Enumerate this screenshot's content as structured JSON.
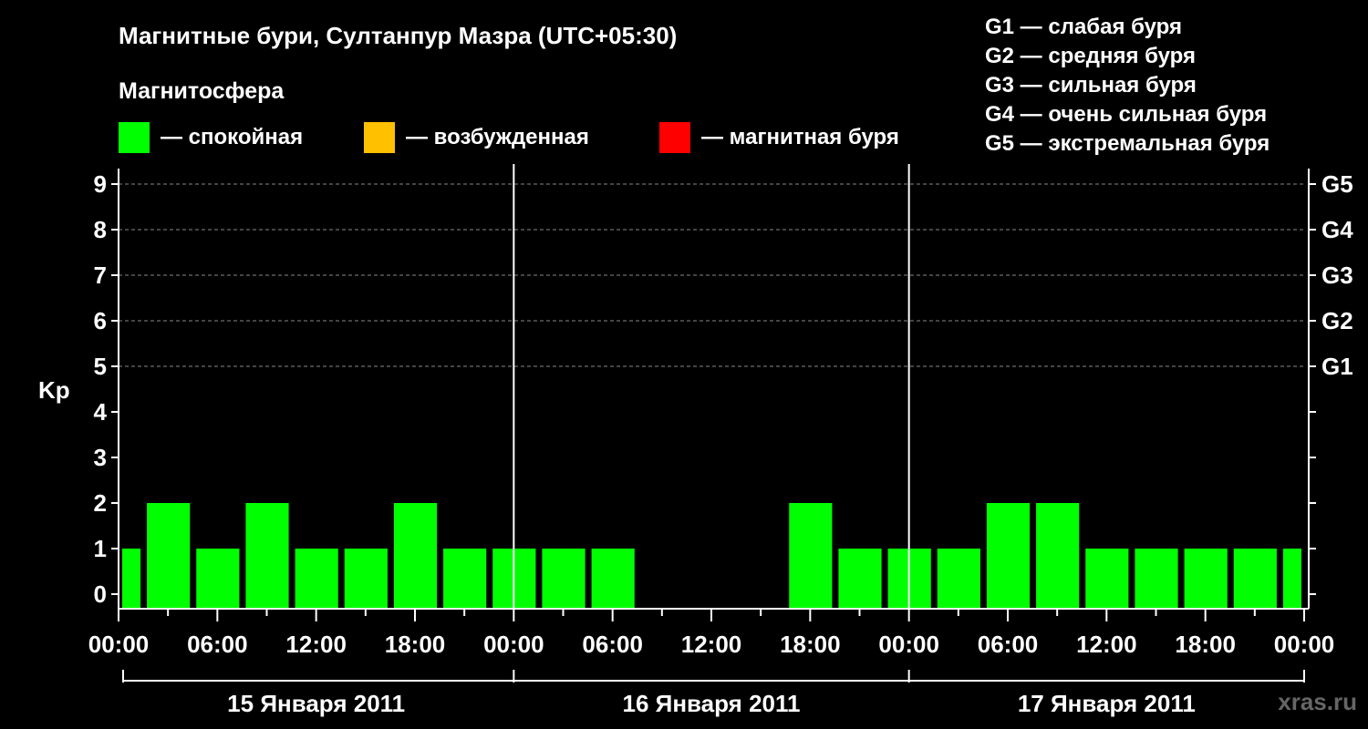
{
  "title": "Магнитные бури, Султанпур Мазра (UTC+05:30)",
  "subtitle": "Магнитосфера",
  "legend": [
    {
      "color": "#00ff00",
      "label": "— спокойная"
    },
    {
      "color": "#ffc000",
      "label": "— возбужденная"
    },
    {
      "color": "#ff0000",
      "label": "— магнитная буря"
    }
  ],
  "storm_levels": [
    "G1 — слабая буря",
    "G2 — средняя буря",
    "G3 — сильная буря",
    "G4 — очень сильная буря",
    "G5 — экстремальная буря"
  ],
  "watermark": "xras.ru",
  "chart_data": {
    "type": "bar",
    "ylabel": "Kp",
    "ylim": [
      0,
      9
    ],
    "yticks": [
      0,
      1,
      2,
      3,
      4,
      5,
      6,
      7,
      8,
      9
    ],
    "right_ticks": [
      {
        "value": 5,
        "label": "G1"
      },
      {
        "value": 6,
        "label": "G2"
      },
      {
        "value": 7,
        "label": "G3"
      },
      {
        "value": 8,
        "label": "G4"
      },
      {
        "value": 9,
        "label": "G5"
      }
    ],
    "xlim_hours": [
      0,
      72
    ],
    "xtick_labels": [
      "00:00",
      "06:00",
      "12:00",
      "18:00",
      "00:00",
      "06:00",
      "12:00",
      "18:00",
      "00:00",
      "06:00",
      "12:00",
      "18:00",
      "00:00"
    ],
    "days": [
      "15 Января 2011",
      "16 Января 2011",
      "17 Января 2011"
    ],
    "colors": {
      "quiet": "#00ff00",
      "active": "#ffc000",
      "storm": "#ff0000"
    },
    "bars": [
      {
        "start": 0,
        "end": 1.5,
        "value": 1
      },
      {
        "start": 1.5,
        "end": 4.5,
        "value": 2
      },
      {
        "start": 4.5,
        "end": 7.5,
        "value": 1
      },
      {
        "start": 7.5,
        "end": 10.5,
        "value": 2
      },
      {
        "start": 10.5,
        "end": 13.5,
        "value": 1
      },
      {
        "start": 13.5,
        "end": 16.5,
        "value": 1
      },
      {
        "start": 16.5,
        "end": 19.5,
        "value": 2
      },
      {
        "start": 19.5,
        "end": 22.5,
        "value": 1
      },
      {
        "start": 22.5,
        "end": 25.5,
        "value": 1
      },
      {
        "start": 25.5,
        "end": 28.5,
        "value": 1
      },
      {
        "start": 28.5,
        "end": 31.5,
        "value": 1
      },
      {
        "start": 31.5,
        "end": 34.5,
        "value": 0
      },
      {
        "start": 34.5,
        "end": 37.5,
        "value": 0
      },
      {
        "start": 37.5,
        "end": 40.5,
        "value": 0
      },
      {
        "start": 40.5,
        "end": 43.5,
        "value": 2
      },
      {
        "start": 43.5,
        "end": 46.5,
        "value": 1
      },
      {
        "start": 46.5,
        "end": 49.5,
        "value": 1
      },
      {
        "start": 49.5,
        "end": 52.5,
        "value": 1
      },
      {
        "start": 52.5,
        "end": 55.5,
        "value": 2
      },
      {
        "start": 55.5,
        "end": 58.5,
        "value": 2
      },
      {
        "start": 58.5,
        "end": 61.5,
        "value": 1
      },
      {
        "start": 61.5,
        "end": 64.5,
        "value": 1
      },
      {
        "start": 64.5,
        "end": 67.5,
        "value": 1
      },
      {
        "start": 67.5,
        "end": 70.5,
        "value": 1
      },
      {
        "start": 70.5,
        "end": 72,
        "value": 1
      }
    ]
  }
}
